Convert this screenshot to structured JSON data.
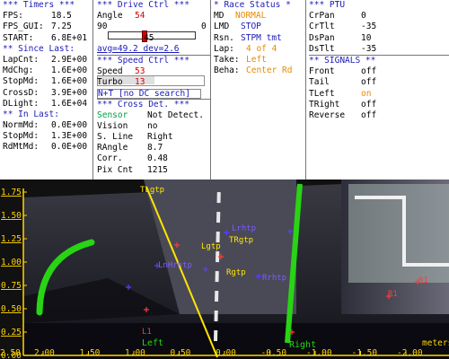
{
  "timers": {
    "header": "*** Timers ***",
    "rows": [
      {
        "label": "FPS:",
        "value": "18.5"
      },
      {
        "label": "FPS_GUI:",
        "value": "7.25"
      },
      {
        "label": "START:",
        "value": "6.8E+01"
      }
    ],
    "since_header": "** Since Last:",
    "since_rows": [
      {
        "label": "LapCnt:",
        "value": "2.9E+00"
      },
      {
        "label": "MdChg:",
        "value": "1.6E+00"
      },
      {
        "label": "StopMd:",
        "value": "1.6E+00"
      },
      {
        "label": "CrossD:",
        "value": "3.9E+00"
      },
      {
        "label": "DLight:",
        "value": "1.6E+04"
      }
    ],
    "in_header": "** In Last:",
    "in_rows": [
      {
        "label": "NormMd:",
        "value": "0.0E+00"
      },
      {
        "label": "StopMd:",
        "value": "1.3E+00"
      },
      {
        "label": "RdMtMd:",
        "value": "0.0E+00"
      }
    ]
  },
  "drive": {
    "header": "***  Drive Ctrl  ***",
    "angle_label": "Angle",
    "angle_value": "54",
    "slider_left": "90",
    "slider_right": "0",
    "slider_level": 0.4,
    "slider_mid": "45",
    "avg_text": "avg=49.2 dev=2.6",
    "speed_header": "***  Speed Ctrl  ***",
    "speed_label": "Speed",
    "speed_value": "53",
    "speed_level": 0.53,
    "turbo_label": "Turbo",
    "turbo_value": "13",
    "nt_text": "N+T [no DC search]",
    "cross_header": "*** Cross Det. ***",
    "cross_rows": [
      {
        "label": "Sensor",
        "value": "Not Detect."
      },
      {
        "label": "Vision",
        "value": "no"
      },
      {
        "label": "S. Line",
        "value": "Right"
      },
      {
        "label": "RAngle",
        "value": "8.7"
      },
      {
        "label": "Corr.",
        "value": "0.48"
      },
      {
        "label": "Pix Cnt",
        "value": "1215"
      }
    ]
  },
  "race": {
    "header": "* Race Status *",
    "rows": [
      {
        "label": "MD",
        "value": "NORMAL"
      },
      {
        "label": "LMD",
        "value": "STOP"
      },
      {
        "label": "Rsn.",
        "value": "STPM tmt"
      },
      {
        "label": "Lap:",
        "value": "4 of 4"
      },
      {
        "label": "Take:",
        "value": "Left"
      },
      {
        "label": "Beha:",
        "value": "Center Rd"
      }
    ]
  },
  "ptu": {
    "header": "*** PTU",
    "rows": [
      {
        "label": "CrPan",
        "value": "0"
      },
      {
        "label": "CrTlt",
        "value": "-35"
      },
      {
        "label": "DsPan",
        "value": "10"
      },
      {
        "label": "DsTlt",
        "value": "-35"
      }
    ],
    "signals_header": "** SIGNALS **",
    "signals": [
      {
        "label": "Front",
        "value": "off"
      },
      {
        "label": "Tail",
        "value": "off"
      },
      {
        "label": "TLeft",
        "value": "on"
      },
      {
        "label": "TRight",
        "value": "off"
      },
      {
        "label": "Reverse",
        "value": "off"
      }
    ]
  },
  "camera": {
    "y_ticks": [
      "1.75",
      "1.50",
      "1.25",
      "1.00",
      "0.75",
      "0.50",
      "0.25",
      "0.00"
    ],
    "x_ticks": [
      "2.00",
      "1.50",
      "1.00",
      "0.50",
      "0.00",
      "-0.50",
      "-1.00",
      "-1.50",
      "-2.00"
    ],
    "x_left_tick": "2.50",
    "x_unit": "meters",
    "labels": {
      "tlgtp": "TLgtp",
      "lgtp": "Lgtp",
      "trgtp": "TRgtp",
      "rgtp": "Rgtp",
      "left": "Left",
      "right": "Right",
      "l1": "L1",
      "r1": "R1",
      "r1a": "R1",
      "lrthtp": "Lrhtp",
      "rrhtp": "Rrhtp",
      "lnhrtp": "LnHrhtp"
    }
  },
  "colors": {
    "blue": "#1a1ab8",
    "red": "#d10000",
    "orange": "#e88a00",
    "green": "#00a040",
    "lane_green": "#28d414",
    "yellow_line": "#ffe600"
  }
}
